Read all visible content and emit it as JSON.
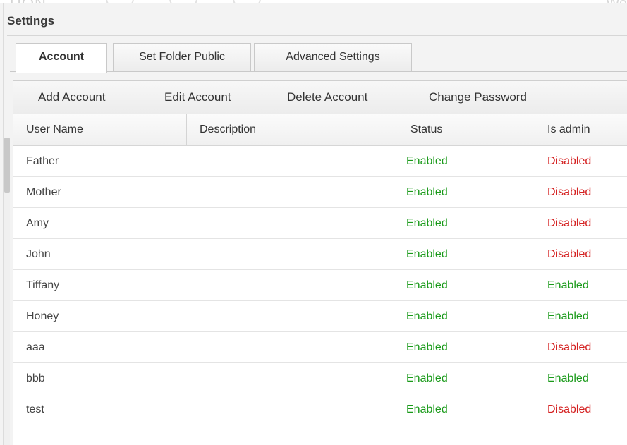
{
  "background": {
    "logo_text": "UON",
    "right_text": "We"
  },
  "dialog": {
    "title": "Settings"
  },
  "tabs": [
    {
      "label": "Account",
      "active": true
    },
    {
      "label": "Set Folder Public",
      "active": false
    },
    {
      "label": "Advanced Settings",
      "active": false
    }
  ],
  "toolbar": {
    "add_label": "Add Account",
    "edit_label": "Edit Account",
    "delete_label": "Delete Account",
    "change_password_label": "Change Password"
  },
  "table": {
    "columns": [
      "User Name",
      "Description",
      "Status",
      "Is admin"
    ],
    "rows": [
      {
        "user": "Father",
        "description": "",
        "status": "Enabled",
        "is_admin": "Disabled"
      },
      {
        "user": "Mother",
        "description": "",
        "status": "Enabled",
        "is_admin": "Disabled"
      },
      {
        "user": "Amy",
        "description": "",
        "status": "Enabled",
        "is_admin": "Disabled"
      },
      {
        "user": "John",
        "description": "",
        "status": "Enabled",
        "is_admin": "Disabled"
      },
      {
        "user": "Tiffany",
        "description": "",
        "status": "Enabled",
        "is_admin": "Enabled"
      },
      {
        "user": "Honey",
        "description": "",
        "status": "Enabled",
        "is_admin": "Enabled"
      },
      {
        "user": "aaa",
        "description": "",
        "status": "Enabled",
        "is_admin": "Disabled"
      },
      {
        "user": "bbb",
        "description": "",
        "status": "Enabled",
        "is_admin": "Enabled"
      },
      {
        "user": "test",
        "description": "",
        "status": "Enabled",
        "is_admin": "Disabled"
      }
    ]
  },
  "colors": {
    "enabled": "#1a9a1a",
    "disabled": "#d42020"
  }
}
